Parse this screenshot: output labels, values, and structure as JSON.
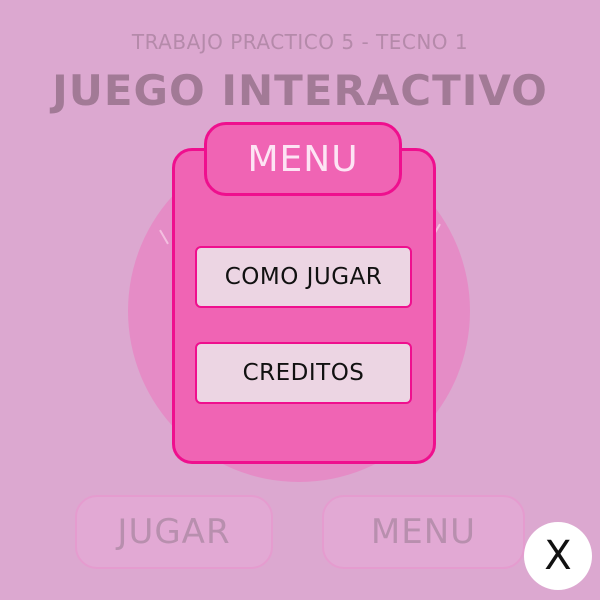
{
  "header": {
    "subtitle": "TRABAJO PRACTICO 5 - TECNO 1",
    "title": "JUEGO INTERACTIVO"
  },
  "background_buttons": {
    "play_label": "JUGAR",
    "menu_label": "MENU"
  },
  "menu_popup": {
    "title": "MENU",
    "items": [
      {
        "label": "COMO JUGAR"
      },
      {
        "label": "CREDITOS"
      }
    ]
  },
  "close_button": {
    "label": "X",
    "icon": "close-icon"
  },
  "colors": {
    "background": "#dca8d0",
    "panel": "#f064b4",
    "panel_border": "#ef0f8e",
    "item_background": "#ecd5e3",
    "circle": "#e58cc6"
  }
}
